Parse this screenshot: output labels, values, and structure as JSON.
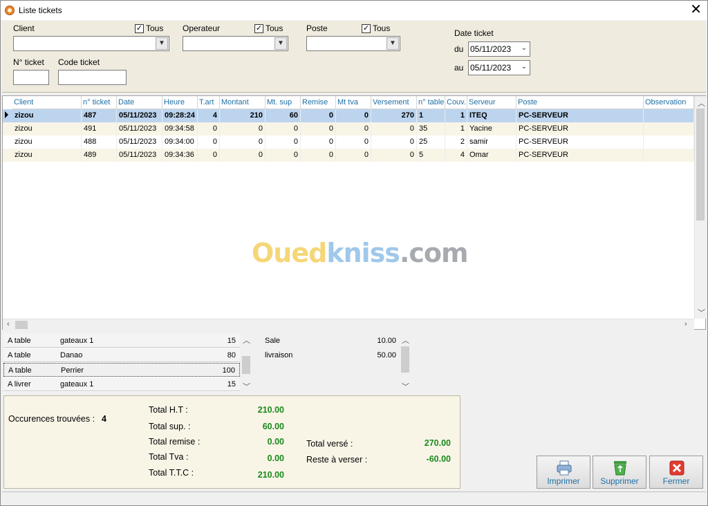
{
  "window": {
    "title": "Liste tickets"
  },
  "filters": {
    "client_label": "Client",
    "operateur_label": "Operateur",
    "poste_label": "Poste",
    "tous_label": "Tous",
    "num_ticket_label": "N° ticket",
    "code_ticket_label": "Code  ticket",
    "date_ticket_label": "Date ticket",
    "du_label": "du",
    "au_label": "au",
    "date_du": "05/11/2023",
    "date_au": "05/11/2023"
  },
  "grid": {
    "columns": [
      "Client",
      "n° ticket",
      "Date",
      "Heure",
      "T.art",
      "Montant",
      "Mt. sup",
      "Remise",
      "Mt tva",
      "Versement",
      "n° table",
      "Couv.",
      "Serveur",
      "Poste",
      "Observation"
    ],
    "rows": [
      [
        "zizou",
        "487",
        "05/11/2023",
        "09:28:24",
        "4",
        "210",
        "60",
        "0",
        "0",
        "270",
        "1",
        "1",
        "ITEQ",
        "PC-SERVEUR",
        ""
      ],
      [
        "zizou",
        "491",
        "05/11/2023",
        "09:34:58",
        "0",
        "0",
        "0",
        "0",
        "0",
        "0",
        "35",
        "1",
        "Yacine",
        "PC-SERVEUR",
        ""
      ],
      [
        "zizou",
        "488",
        "05/11/2023",
        "09:34:00",
        "0",
        "0",
        "0",
        "0",
        "0",
        "0",
        "25",
        "2",
        "samir",
        "PC-SERVEUR",
        ""
      ],
      [
        "zizou",
        "489",
        "05/11/2023",
        "09:34:36",
        "0",
        "0",
        "0",
        "0",
        "0",
        "0",
        "5",
        "4",
        "Omar",
        "PC-SERVEUR",
        ""
      ]
    ]
  },
  "watermark": {
    "part1": "Oued",
    "part2": "kniss",
    "part3": ".com"
  },
  "detail_items": [
    {
      "type": "A table",
      "name": "gateaux 1",
      "qty": "15"
    },
    {
      "type": "A table",
      "name": "Danao",
      "qty": "80"
    },
    {
      "type": "A table",
      "name": "Perrier",
      "qty": "100"
    },
    {
      "type": "A livrer",
      "name": "gateaux 1",
      "qty": "15"
    }
  ],
  "fees": [
    {
      "name": "Sale",
      "value": "10.00"
    },
    {
      "name": "livraison",
      "value": "50.00"
    }
  ],
  "totals": {
    "occurrences_label": "Occurences trouvées :",
    "occurrences_value": "4",
    "total_ht_label": "Total H.T :",
    "total_ht_value": "210.00",
    "total_sup_label": "Total sup. :",
    "total_sup_value": "60.00",
    "total_remise_label": "Total remise :",
    "total_remise_value": "0.00",
    "total_tva_label": "Total Tva :",
    "total_tva_value": "0.00",
    "total_ttc_label": "Total T.T.C :",
    "total_ttc_value": "210.00",
    "total_verse_label": "Total versé :",
    "total_verse_value": "270.00",
    "reste_label": "Reste à verser :",
    "reste_value": "-60.00"
  },
  "buttons": {
    "imprimer": "Imprimer",
    "supprimer": "Supprimer",
    "fermer": "Fermer"
  },
  "colors": {
    "accent": "#1d6fa5",
    "total_green": "#1a8a1a",
    "selected_row": "#bcd4ee",
    "panel_bg": "#efebdf"
  }
}
